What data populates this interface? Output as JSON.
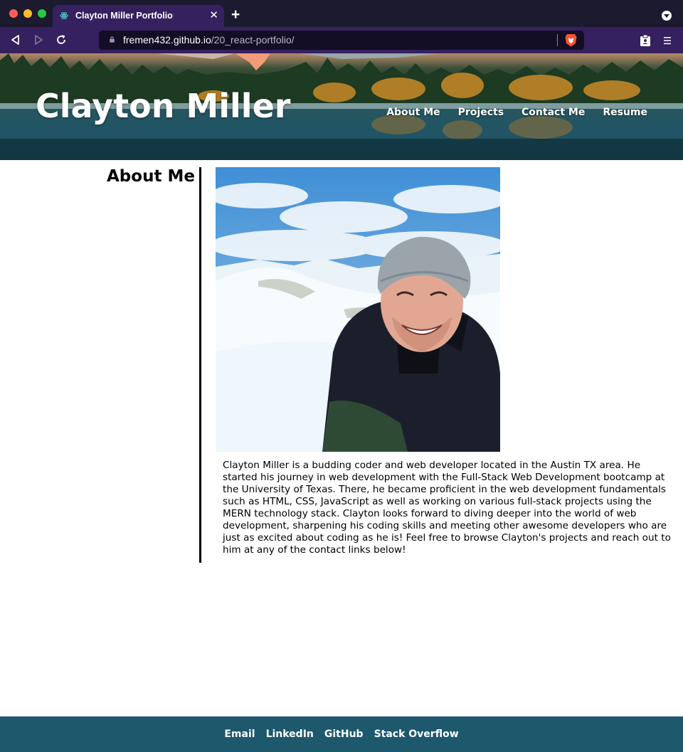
{
  "browser": {
    "tab_title": "Clayton Miller Portfolio",
    "tab_close": "✕",
    "new_tab": "+",
    "url_host": "fremen432.github.io",
    "url_path": "/20_react-portfolio/"
  },
  "header": {
    "title": "Clayton Miller",
    "nav": [
      {
        "label": "About Me"
      },
      {
        "label": "Projects"
      },
      {
        "label": "Contact Me"
      },
      {
        "label": "Resume"
      }
    ]
  },
  "about": {
    "heading": "About Me",
    "bio": "Clayton Miller is a budding coder and web developer located in the Austin TX area. He started his journey in web development with the Full-Stack Web Development bootcamp at the University of Texas. There, he became proficient in the web development fundamentals such as HTML, CSS, JavaScript as well as working on various full-stack projects using the MERN technology stack. Clayton looks forward to diving deeper into the world of web development, sharpening his coding skills and meeting other awesome developers who are just as excited about coding as he is! Feel free to browse Clayton's projects and reach out to him at any of the contact links below!"
  },
  "footer": {
    "links": [
      {
        "label": "Email"
      },
      {
        "label": "LinkedIn"
      },
      {
        "label": "GitHub"
      },
      {
        "label": "Stack Overflow"
      }
    ]
  },
  "colors": {
    "chrome_dark": "#1c1a2e",
    "chrome_purple": "#35215f",
    "footer_teal": "#1d586d"
  },
  "icons": {
    "tab_favicon": "react-logo-icon",
    "back": "back-triangle-icon",
    "forward": "forward-triangle-icon",
    "reload": "reload-icon",
    "lock": "lock-icon",
    "brave": "brave-lion-icon",
    "wallet": "wallet-icon",
    "menu": "hamburger-menu-icon"
  }
}
